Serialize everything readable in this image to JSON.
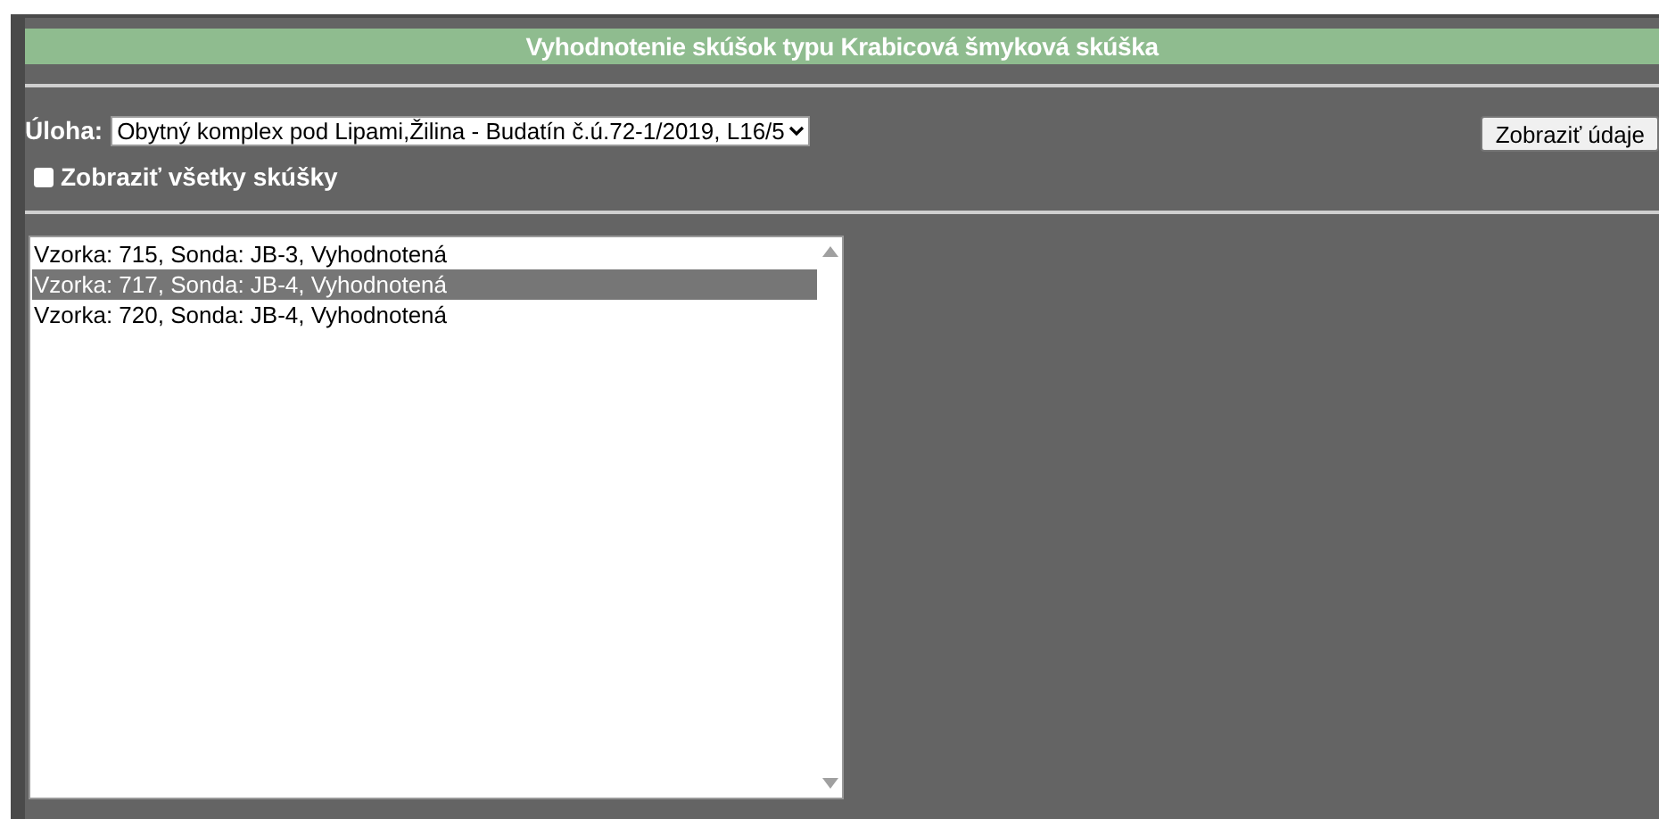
{
  "header": {
    "title": "Vyhodnotenie skúšok typu Krabicová šmyková skúška"
  },
  "task": {
    "label": "Úloha:",
    "value": "Obytný komplex pod Lipami,Žilina - Budatín č.ú.72-1/2019, L16/5"
  },
  "show_all": {
    "label": "Zobraziť všetky skúšky",
    "checked": false
  },
  "show_button": {
    "label": "Zobraziť údaje"
  },
  "samples": [
    {
      "label": "Vzorka: 715, Sonda: JB-3, Vyhodnotená",
      "selected": false
    },
    {
      "label": "Vzorka: 717, Sonda: JB-4, Vyhodnotená",
      "selected": true
    },
    {
      "label": "Vzorka: 720, Sonda: JB-4, Vyhodnotená",
      "selected": false
    }
  ]
}
